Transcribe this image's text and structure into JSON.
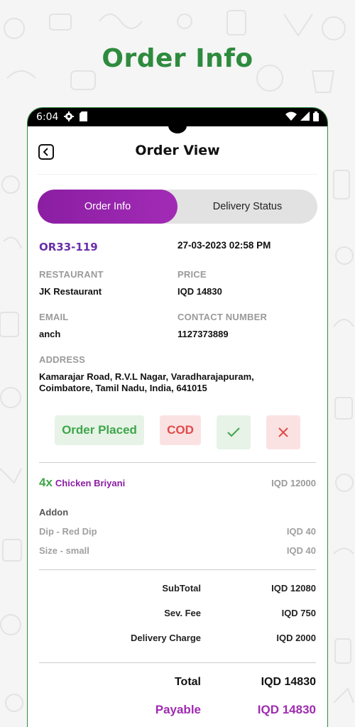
{
  "hero": {
    "title": "Order Info"
  },
  "status_bar": {
    "time": "6:04"
  },
  "app_bar": {
    "title": "Order View"
  },
  "tabs": [
    {
      "label": "Order Info",
      "active": true
    },
    {
      "label": "Delivery Status",
      "active": false
    }
  ],
  "order": {
    "id": "OR33-119",
    "datetime": "27-03-2023 02:58 PM",
    "restaurant_label": "RESTAURANT",
    "restaurant": "JK Restaurant",
    "price_label": "PRICE",
    "price": "IQD 14830",
    "email_label": "EMAIL",
    "email": "anch",
    "contact_label": "CONTACT NUMBER",
    "contact": "1127373889",
    "address_label": "ADDRESS",
    "address": "Kamarajar Road, R.V.L Nagar, Varadharajapuram, Coimbatore, Tamil Nadu, India, 641015"
  },
  "status_chips": {
    "order_status": "Order Placed",
    "payment_method": "COD"
  },
  "items": [
    {
      "qty": "4x",
      "name": "Chicken Briyani",
      "price": "IQD 12000",
      "addon_title": "Addon",
      "addons": [
        {
          "name": "Dip - Red Dip",
          "price": "IQD 40"
        },
        {
          "name": "Size - small",
          "price": "IQD 40"
        }
      ]
    }
  ],
  "summary": {
    "subtotal_label": "SubTotal",
    "subtotal": "IQD 12080",
    "service_fee_label": "Sev. Fee",
    "service_fee": "IQD 750",
    "delivery_label": "Delivery Charge",
    "delivery": "IQD 2000",
    "total_label": "Total",
    "total": "IQD 14830",
    "payable_label": "Payable",
    "payable": "IQD 14830"
  },
  "colors": {
    "brand_green": "#2e8b3e",
    "accent_purple": "#8b1ea3",
    "status_green": "#3fa54a",
    "status_red": "#e24a4a"
  },
  "icons": [
    "settings-icon",
    "sd-card-icon",
    "wifi-icon",
    "signal-icon",
    "battery-icon",
    "back-icon",
    "check-icon",
    "close-icon"
  ]
}
